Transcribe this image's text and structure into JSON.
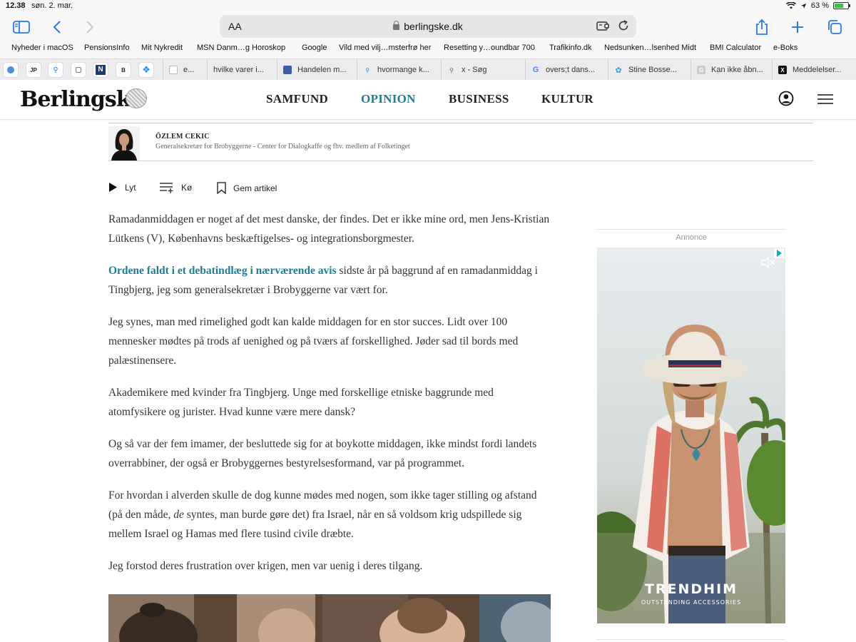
{
  "status_bar": {
    "time": "12.38",
    "date": "søn. 2. mar.",
    "battery": "63 %"
  },
  "browser": {
    "address_aa": "AA",
    "url": "berlingske.dk",
    "bookmarks": [
      "Nyheder i macOS",
      "PensionsInfo",
      "Mit Nykredit",
      "MSN Danm…g Horoskop",
      "Google",
      "Vild med vilj…msterfrø her",
      "Resetting y…oundbar 700",
      "Trafikinfo.dk",
      "Nedsunken…lsenhed Midt",
      "BMI Calculator",
      "e-Boks"
    ],
    "pinned_tabs": [
      "JP",
      "B"
    ],
    "tabs": [
      "e...",
      "hvilke varer i...",
      "Handelen m...",
      "hvormange k...",
      "x - Søg",
      "overs;t dans...",
      "Stine Bosse...",
      "Kan ikke åbn...",
      "Meddelelser..."
    ]
  },
  "site": {
    "logo": "Berlingske",
    "nav": [
      {
        "label": "SAMFUND"
      },
      {
        "label": "OPINION"
      },
      {
        "label": "BUSINESS"
      },
      {
        "label": "KULTUR"
      }
    ]
  },
  "author": {
    "name": "ÖZLEM CEKIC",
    "description": "Generalsekretær for Brobyggerne - Center for Dialogkaffe og fhv. medlem af Folketinget"
  },
  "actions": {
    "listen": "Lyt",
    "queue": "Kø",
    "save": "Gem artikel"
  },
  "article": {
    "p1": "Ramadanmiddagen er noget af det mest danske, der findes. Det er ikke mine ord, men Jens-Kristian Lütkens (V), Københavns beskæftigelses- og integrationsborgmester.",
    "p2_link": "Ordene faldt i et debatindlæg i nærværende avis",
    "p2_rest": " sidste år på baggrund af en ramadanmiddag i Tingbjerg, jeg som generalsekretær i Brobyggerne var vært for.",
    "p3": "Jeg synes, man med rimelighed godt kan kalde middagen for en stor succes. Lidt over 100 mennesker mødtes på trods af uenighed og på tværs af forskellighed. Jøder sad til bords med palæstinensere.",
    "p4": "Akademikere med kvinder fra Tingbjerg. Unge med forskellige etniske baggrunde med atomfysikere og jurister. Hvad kunne være mere dansk?",
    "p5": "Og så var der fem imamer, der besluttede sig for at boykotte middagen, ikke mindst fordi landets overrabbiner, der også er Brobyggernes bestyrelsesformand, var på programmet.",
    "p6_a": "For hvordan i alverden skulle de dog kunne mødes med nogen, som ikke tager stilling og afstand (på den måde, ",
    "p6_em": "de",
    "p6_b": " syntes, man burde gøre det) fra Israel, når en så voldsom krig udspillede sig mellem Israel og Hamas med flere tusind civile dræbte.",
    "p7": "Jeg forstod deres frustration over krigen, men var uenig i deres tilgang."
  },
  "ad": {
    "label": "Annonce",
    "brand": "TRENDHIM",
    "tagline": "OUTSTANDING ACCESSORIES"
  },
  "colors": {
    "accent": "#1a7f94",
    "safari_blue": "#2a7ae2"
  }
}
